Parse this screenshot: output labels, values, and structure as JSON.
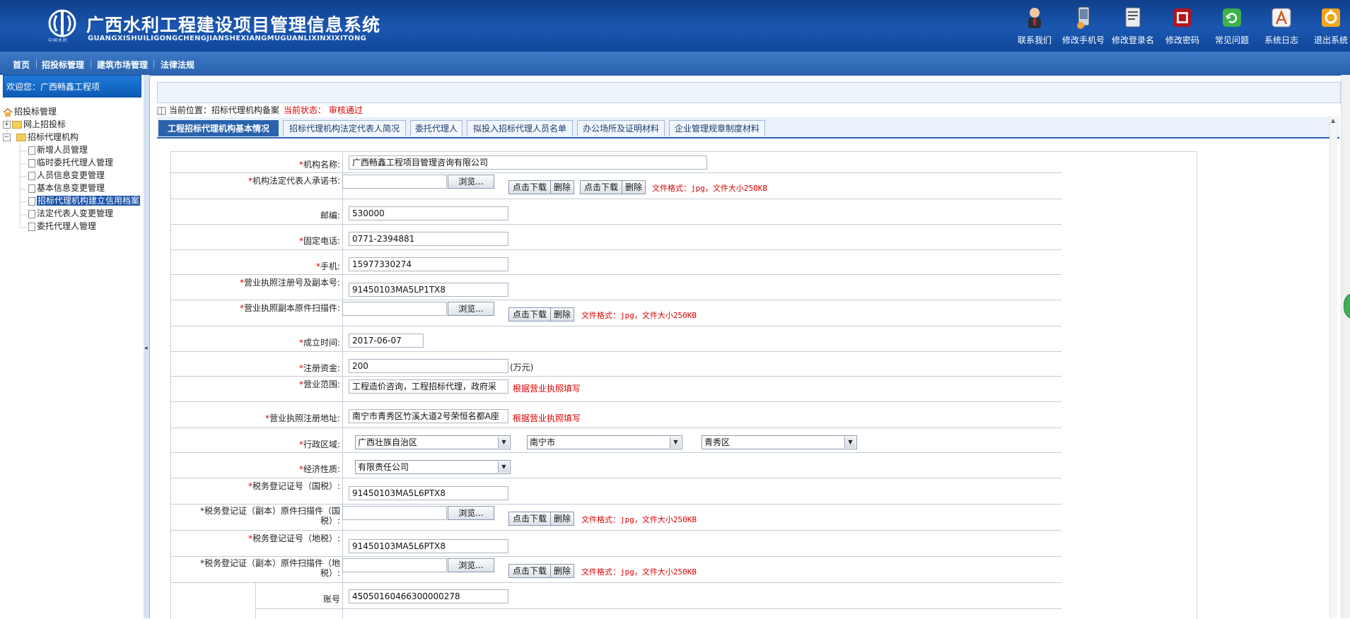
{
  "header": {
    "title": "广西水利工程建设项目管理信息系统",
    "subtitle": "GUANGXISHUILIGONGCHENGJIANSHEXIANGMUGUANLIXINXIXITONG",
    "logo_caption": "中国水利",
    "tools": [
      {
        "label": "联系我们",
        "icon": "user-icon"
      },
      {
        "label": "修改手机号",
        "icon": "mobile-icon"
      },
      {
        "label": "修改登录名",
        "icon": "document-icon"
      },
      {
        "label": "修改密码",
        "icon": "lock-icon"
      },
      {
        "label": "常见问题",
        "icon": "refresh-icon"
      },
      {
        "label": "系统日志",
        "icon": "log-icon"
      },
      {
        "label": "退出系统",
        "icon": "exit-icon"
      }
    ]
  },
  "menu": {
    "items": [
      "首页",
      "招投标管理",
      "建筑市场管理",
      "法律法规"
    ]
  },
  "sidebar": {
    "welcome": "欢迎您：广西畅鑫工程项",
    "tree": {
      "root": "招投标管理",
      "nodes": [
        {
          "label": "网上招投标",
          "type": "folder"
        },
        {
          "label": "招标代理机构",
          "type": "folder"
        },
        {
          "label": "新增人员管理",
          "type": "doc"
        },
        {
          "label": "临时委托代理人管理",
          "type": "doc"
        },
        {
          "label": "人员信息变更管理",
          "type": "doc"
        },
        {
          "label": "基本信息变更管理",
          "type": "doc"
        },
        {
          "label": "招标代理机构建立信用档案",
          "type": "doc"
        },
        {
          "label": "法定代表人变更管理",
          "type": "doc"
        },
        {
          "label": "委托代理人管理",
          "type": "doc"
        }
      ]
    }
  },
  "breadcrumb": {
    "location": "当前位置：招标代理机构备案",
    "status_label": "当前状态：",
    "status_value": "审核通过"
  },
  "tabs": [
    "工程招标代理机构基本情况",
    "招标代理机构法定代表人简况",
    "委托代理人",
    "拟投入招标代理人员名单",
    "办公场所及证明材料",
    "企业管理规章制度材料"
  ],
  "common": {
    "browse": "浏览...",
    "download": "点击下载",
    "delete": "删除",
    "file_hint": "文件格式：jpg，文件大小250KB",
    "license_hint": "根据营业执照填写",
    "asterisk": "*"
  },
  "form": {
    "org_name": {
      "label": "机构名称:",
      "value": "广西畅鑫工程项目管理咨询有限公司"
    },
    "legal_letter": {
      "label": "机构法定代表人承诺书:"
    },
    "postcode": {
      "label": "邮编:",
      "value": "530000"
    },
    "phone": {
      "label": "固定电话:",
      "value": "0771-2394881"
    },
    "mobile": {
      "label": "手机:",
      "value": "15977330274"
    },
    "license_no": {
      "label": "营业执照注册号及副本号:",
      "value": "91450103MA5LP1TX8"
    },
    "license_scan": {
      "label": "营业执照副本原件扫描件:"
    },
    "founded": {
      "label": "成立时间:",
      "value": "2017-06-07"
    },
    "capital": {
      "label": "注册资金:",
      "value": "200",
      "unit": "(万元)"
    },
    "scope": {
      "label": "营业范围:",
      "value": "工程造价咨询，工程招标代理，政府采"
    },
    "address": {
      "label": "营业执照注册地址:",
      "value": "南宁市青秀区竹溪大道2号荣恒名都A座"
    },
    "region": {
      "label": "行政区域:",
      "province": "广西壮族自治区",
      "city": "南宁市",
      "district": "青秀区"
    },
    "econ_type": {
      "label": "经济性质:",
      "value": "有限责任公司"
    },
    "tax_national_no": {
      "label": "税务登记证号（国税）:",
      "value": "91450103MA5L6PTX8"
    },
    "tax_national_scan": {
      "label_line1": "税务登记证（副本）原件扫描件（国",
      "label_line2": "税）:"
    },
    "tax_local_no": {
      "label": "税务登记证号（地税）:",
      "value": "91450103MA5L6PTX8"
    },
    "tax_local_scan": {
      "label_line1": "税务登记证（副本）原件扫描件（地",
      "label_line2": "税）:"
    },
    "account": {
      "label": "账号",
      "value": "450501604663000002​78"
    }
  }
}
